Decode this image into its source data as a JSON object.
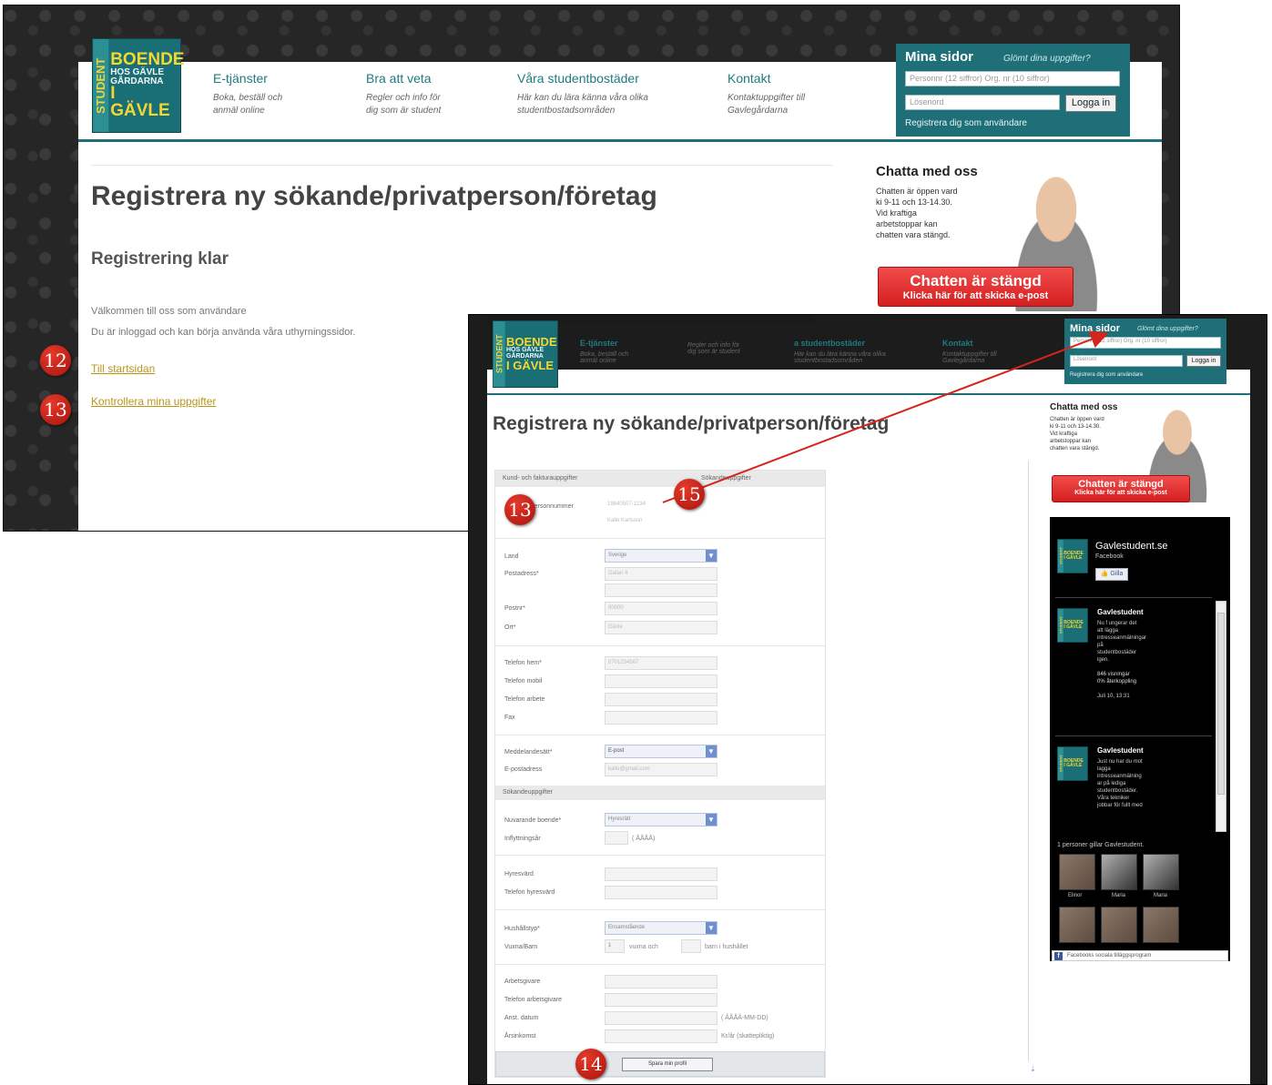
{
  "header": {
    "logo": {
      "side": "STUDENT",
      "lines": [
        "BOENDE",
        "HOS GÄVLE",
        "GÅRDARNA",
        "I GÄVLE"
      ]
    },
    "nav": [
      {
        "title": "E-tjänster",
        "sub": [
          "Boka, beställ och",
          "anmäl online"
        ]
      },
      {
        "title": "Bra att veta",
        "sub": [
          "Regler och info för",
          "dig som är student"
        ]
      },
      {
        "title": "Våra studentbostäder",
        "sub": [
          "Här kan du lära känna våra olika",
          "studentbostadsområden"
        ]
      },
      {
        "title": "Kontakt",
        "sub": [
          "Kontaktuppgifter till",
          "Gavlegårdarna"
        ]
      }
    ],
    "nav_b": [
      {
        "title": "E-tjänster",
        "sub": [
          "Boka, beställ och",
          "anmäl online"
        ]
      },
      {
        "title": "",
        "sub": [
          "Regler och info för",
          "dig som är student"
        ]
      },
      {
        "title": "a studentbostäder",
        "sub": [
          "Här kan du lära känna våra olika",
          "studentbostadsområden"
        ]
      },
      {
        "title": "Kontakt",
        "sub": [
          "Kontaktuppgifter till",
          "Gavlegårdarna"
        ]
      }
    ],
    "mina": {
      "title": "Mina sidor",
      "forgot": "Glömt dina uppgifter?",
      "user_placeholder": "Personnr (12 siffror) Org. nr (10 siffror)",
      "pass_placeholder": "Lösenord",
      "login": "Logga in",
      "register": "Registrera dig som användare"
    }
  },
  "chat": {
    "title": "Chatta med oss",
    "text": [
      "Chatten är öppen vard",
      "ki 9-11 och 13-14.30.",
      "Vid kraftiga",
      "arbetstoppar kan",
      "chatten vara stängd."
    ],
    "btn_main": "Chatten är stängd",
    "btn_sub": "Klicka här för att skicka e-post"
  },
  "pageA": {
    "title": "Registrera ny sökande/privatperson/företag",
    "subtitle": "Registrering klar",
    "lines": [
      "Välkommen till oss som användare",
      "Du är inloggad och kan börja använda våra uthyrningssidor."
    ],
    "link_start": "Till startsidan",
    "link_check": "Kontrollera mina uppgifter"
  },
  "pageB": {
    "title": "Registrera ny sökande/privatperson/företag",
    "tab1": "Kund- och fakturauppgifter",
    "tab2": "Sökandeuppgifter",
    "name_label": "Personnummer",
    "name_val1": "19840507-1234",
    "name_val2": "Kalle Karlsson",
    "fields": {
      "land": "Land",
      "land_val": "Sverige",
      "postadress": "Postadress*",
      "postadress_val": "Gatan 4",
      "postnr": "Postnr*",
      "postnr_val": "80000",
      "ort": "Ort*",
      "ort_val": "Gävle",
      "tel_hem": "Telefon hem*",
      "tel_hem_val": "0701234567",
      "tel_mobil": "Telefon mobil",
      "tel_arbete": "Telefon arbete",
      "fax": "Fax",
      "medd": "Meddelandesätt*",
      "medd_val": "E-post",
      "epost": "E-postadress",
      "epost_val": "kalle@gmail.com"
    },
    "sokande_head": "Sökandeuppgifter",
    "sok": {
      "boende": "Nuvarande boende*",
      "boende_val": "Hyresrätt",
      "inflytt": "Inflyttningsår",
      "inflytt_hint": "( ÅÅÅÅ)",
      "hyresvard": "Hyresvärd",
      "tel_hyresvard": "Telefon hyresvärd",
      "hushall": "Hushållstyp*",
      "hushall_val": "Ensamstående",
      "vuxna": "Vuxna/Barn",
      "vuxna_val": "1",
      "vuxna_hint": "vuxna och",
      "barn_hint": "barn i hushållet",
      "arbetsgivare": "Arbetsgivare",
      "tel_arbetsgivare": "Telefon arbetsgivare",
      "anst": "Anst. datum",
      "anst_hint": "( ÅÅÅÅ-MM-DD)",
      "arsinkomst": "Årsinkomst",
      "ars_hint": "Kr/år (skattepliktig)"
    },
    "save": "Spara min profil"
  },
  "facebook": {
    "page": "Gavlestudent.se",
    "sub": "Facebook",
    "like": "Gilla",
    "posts": [
      {
        "author": "Gavlestudent",
        "text": [
          "Nu f ungerar det",
          "att lägga",
          "intresseanmälningar",
          "på",
          "studentbostäder",
          "igen."
        ],
        "extra": [
          "846 visningar",
          "0% återkoppling"
        ],
        "time": "Juli 10, 13:31"
      },
      {
        "author": "Gavlestudent",
        "text": [
          "Just nu har du mot",
          "lagga",
          "intresseanmälning",
          "ar på lediga",
          "studentbostäder.",
          "Våra tekniker",
          "jobbar för fullt med"
        ]
      }
    ],
    "likes": "1 personer gillar Gavlestudent.",
    "names": [
      "Elinor",
      "Maria",
      "Maria"
    ],
    "footer": "Facebooks sociala tilläggsprogram"
  },
  "badges": [
    "12",
    "13",
    "13",
    "15",
    "14"
  ]
}
